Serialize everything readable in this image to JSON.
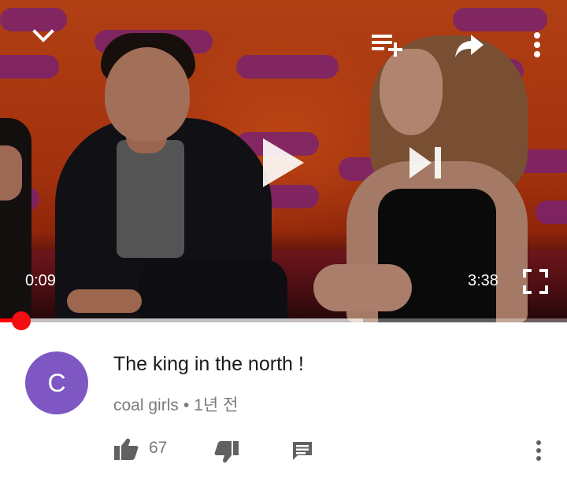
{
  "player": {
    "current_time": "0:09",
    "duration": "3:38",
    "progress_fraction": 0.041,
    "buffered_fraction": 0.64,
    "accent_color": "#ff0000",
    "icons": {
      "collapse": "chevron-down-icon",
      "add_to_playlist": "playlist-add-icon",
      "share": "share-icon",
      "more": "more-vertical-icon",
      "play": "play-icon",
      "next": "skip-next-icon",
      "fullscreen": "fullscreen-icon"
    }
  },
  "comment": {
    "avatar_letter": "C",
    "avatar_color": "#7e57c2",
    "text": "The king in the north !",
    "author": "coal girls",
    "separator": "•",
    "time_ago": "1년 전",
    "like_count": "67",
    "icons": {
      "like": "thumbs-up-icon",
      "dislike": "thumbs-down-icon",
      "reply": "comment-icon",
      "more": "more-vertical-icon"
    }
  }
}
